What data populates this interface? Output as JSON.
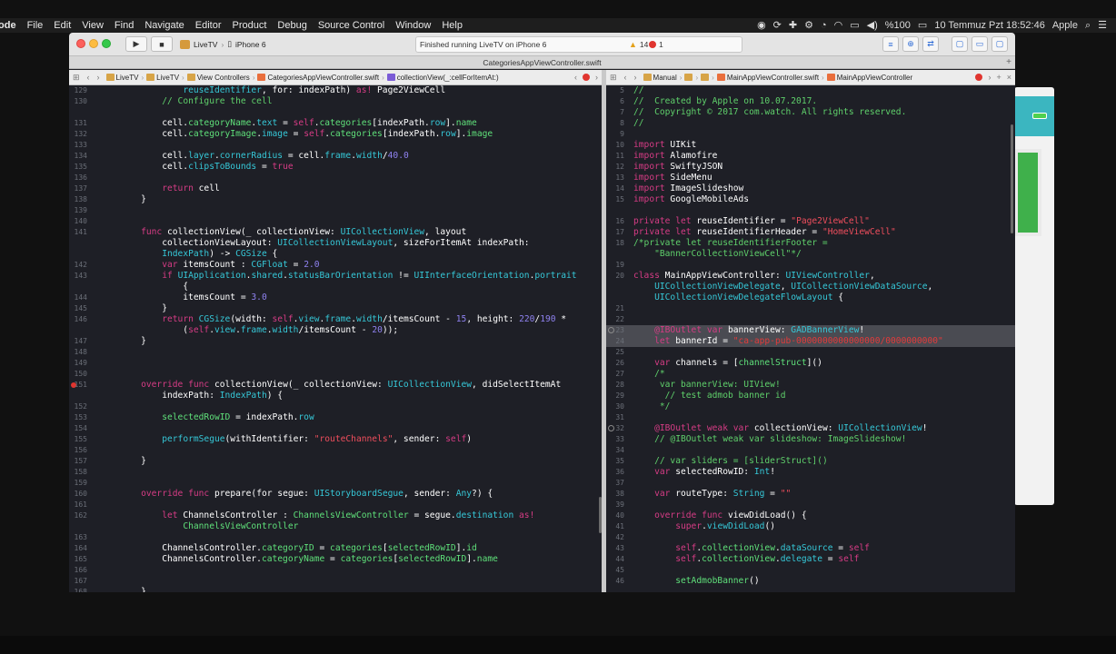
{
  "menubar": {
    "app": "ode",
    "items": [
      "File",
      "Edit",
      "View",
      "Find",
      "Navigate",
      "Editor",
      "Product",
      "Debug",
      "Source Control",
      "Window",
      "Help"
    ],
    "battery": "%100",
    "datetime": "10 Temmuz Pzt  18:52:46",
    "user": "Apple"
  },
  "toolbar": {
    "scheme": "LiveTV",
    "device": "iPhone 6",
    "status": "Finished running LiveTV on iPhone 6",
    "warnings": "14",
    "errors": "1",
    "window_title": "CategoriesAppViewController.swift"
  },
  "left_jump": [
    "LiveTV",
    "LiveTV",
    "View Controllers",
    "CategoriesAppViewController.swift",
    "collectionView(_:cellForItemAt:)"
  ],
  "right_jump": [
    "Manual",
    "MainAppViewController.swift",
    "MainAppViewController"
  ],
  "left_code": [
    {
      "n": "129",
      "h": "            <span class=\"t\">reuseIdentifier</span>, for: indexPath) <span class=\"k\">as!</span> Page2ViewCell"
    },
    {
      "n": "130",
      "h": "        <span class=\"c\">// Configure the cell</span>"
    },
    {
      "n": "",
      "h": ""
    },
    {
      "n": "131",
      "h": "        cell.<span class=\"p\">categoryName</span>.<span class=\"t\">text</span> = <span class=\"k\">self</span>.<span class=\"p\">categories</span>[indexPath.<span class=\"t\">row</span>].<span class=\"p\">name</span>"
    },
    {
      "n": "132",
      "h": "        cell.<span class=\"p\">categoryImage</span>.<span class=\"t\">image</span> = <span class=\"k\">self</span>.<span class=\"p\">categories</span>[indexPath.<span class=\"t\">row</span>].<span class=\"p\">image</span>"
    },
    {
      "n": "133",
      "h": ""
    },
    {
      "n": "134",
      "h": "        cell.<span class=\"t\">layer</span>.<span class=\"t\">cornerRadius</span> = cell.<span class=\"t\">frame</span>.<span class=\"t\">width</span>/<span class=\"n\">40.0</span>"
    },
    {
      "n": "135",
      "h": "        cell.<span class=\"t\">clipsToBounds</span> = <span class=\"k\">true</span>"
    },
    {
      "n": "136",
      "h": ""
    },
    {
      "n": "137",
      "h": "        <span class=\"k\">return</span> cell"
    },
    {
      "n": "138",
      "h": "    }"
    },
    {
      "n": "139",
      "h": ""
    },
    {
      "n": "140",
      "h": ""
    },
    {
      "n": "141",
      "h": "    <span class=\"k\">func</span> collectionView(_ collectionView: <span class=\"t\">UICollectionView</span>, layout"
    },
    {
      "n": "",
      "h": "        collectionViewLayout: <span class=\"t\">UICollectionViewLayout</span>, sizeForItemAt indexPath:"
    },
    {
      "n": "",
      "h": "        <span class=\"t\">IndexPath</span>) -&gt; <span class=\"t\">CGSize</span> {"
    },
    {
      "n": "142",
      "h": "        <span class=\"k\">var</span> itemsCount : <span class=\"t\">CGFloat</span> = <span class=\"n\">2.0</span>"
    },
    {
      "n": "143",
      "h": "        <span class=\"k\">if</span> <span class=\"t\">UIApplication</span>.<span class=\"t\">shared</span>.<span class=\"t\">statusBarOrientation</span> != <span class=\"t\">UIInterfaceOrientation</span>.<span class=\"t\">portrait</span>"
    },
    {
      "n": "",
      "h": "            {"
    },
    {
      "n": "144",
      "h": "            itemsCount = <span class=\"n\">3.0</span>"
    },
    {
      "n": "145",
      "h": "        }"
    },
    {
      "n": "146",
      "h": "        <span class=\"k\">return</span> <span class=\"t\">CGSize</span>(width: <span class=\"k\">self</span>.<span class=\"t\">view</span>.<span class=\"t\">frame</span>.<span class=\"t\">width</span>/itemsCount - <span class=\"n\">15</span>, height: <span class=\"n\">220</span>/<span class=\"n\">190</span> *"
    },
    {
      "n": "",
      "h": "            (<span class=\"k\">self</span>.<span class=\"t\">view</span>.<span class=\"t\">frame</span>.<span class=\"t\">width</span>/itemsCount - <span class=\"n\">20</span>));"
    },
    {
      "n": "147",
      "h": "    }"
    },
    {
      "n": "148",
      "h": ""
    },
    {
      "n": "149",
      "h": ""
    },
    {
      "n": "150",
      "h": ""
    },
    {
      "n": "151",
      "h": "    <span class=\"k\">override</span> <span class=\"k\">func</span> collectionView(_ collectionView: <span class=\"t\">UICollectionView</span>, didSelectItemAt",
      "bp": true
    },
    {
      "n": "",
      "h": "        indexPath: <span class=\"t\">IndexPath</span>) {"
    },
    {
      "n": "152",
      "h": ""
    },
    {
      "n": "153",
      "h": "        <span class=\"p\">selectedRowID</span> = indexPath.<span class=\"t\">row</span>"
    },
    {
      "n": "154",
      "h": ""
    },
    {
      "n": "155",
      "h": "        <span class=\"t\">performSegue</span>(withIdentifier: <span class=\"s\">\"routeChannels\"</span>, sender: <span class=\"k\">self</span>)"
    },
    {
      "n": "156",
      "h": ""
    },
    {
      "n": "157",
      "h": "    }"
    },
    {
      "n": "158",
      "h": ""
    },
    {
      "n": "159",
      "h": ""
    },
    {
      "n": "160",
      "h": "    <span class=\"k\">override</span> <span class=\"k\">func</span> prepare(for segue: <span class=\"t\">UIStoryboardSegue</span>, sender: <span class=\"t\">Any</span>?) {"
    },
    {
      "n": "161",
      "h": ""
    },
    {
      "n": "162",
      "h": "        <span class=\"k\">let</span> ChannelsController : <span class=\"p\">ChannelsViewController</span> = segue.<span class=\"t\">destination</span> <span class=\"k\">as!</span>"
    },
    {
      "n": "",
      "h": "            <span class=\"p\">ChannelsViewController</span>"
    },
    {
      "n": "163",
      "h": ""
    },
    {
      "n": "164",
      "h": "        ChannelsController.<span class=\"p\">categoryID</span> = <span class=\"p\">categories</span>[<span class=\"p\">selectedRowID</span>].<span class=\"p\">id</span>"
    },
    {
      "n": "165",
      "h": "        ChannelsController.<span class=\"p\">categoryName</span> = <span class=\"p\">categories</span>[<span class=\"p\">selectedRowID</span>].<span class=\"p\">name</span>"
    },
    {
      "n": "166",
      "h": ""
    },
    {
      "n": "167",
      "h": ""
    },
    {
      "n": "168",
      "h": "    }"
    }
  ],
  "right_code": [
    {
      "n": "5",
      "h": "<span class=\"c\">//</span>"
    },
    {
      "n": "6",
      "h": "<span class=\"c\">//  Created by Apple on 10.07.2017.</span>"
    },
    {
      "n": "7",
      "h": "<span class=\"c\">//  Copyright © 2017 com.watch. All rights reserved.</span>"
    },
    {
      "n": "8",
      "h": "<span class=\"c\">//</span>"
    },
    {
      "n": "9",
      "h": ""
    },
    {
      "n": "10",
      "h": "<span class=\"k\">import</span> UIKit"
    },
    {
      "n": "11",
      "h": "<span class=\"k\">import</span> Alamofire"
    },
    {
      "n": "12",
      "h": "<span class=\"k\">import</span> SwiftyJSON"
    },
    {
      "n": "13",
      "h": "<span class=\"k\">import</span> SideMenu"
    },
    {
      "n": "14",
      "h": "<span class=\"k\">import</span> ImageSlideshow"
    },
    {
      "n": "15",
      "h": "<span class=\"k\">import</span> GoogleMobileAds"
    },
    {
      "n": "",
      "h": ""
    },
    {
      "n": "16",
      "h": "<span class=\"k\">private</span> <span class=\"k\">let</span> reuseIdentifier = <span class=\"s\">\"Page2ViewCell\"</span>"
    },
    {
      "n": "17",
      "h": "<span class=\"k\">private</span> <span class=\"k\">let</span> reuseIdentifierHeader = <span class=\"s\">\"HomeViewCell\"</span>"
    },
    {
      "n": "18",
      "h": "<span class=\"c\">/*private let reuseIdentifierFooter =</span>"
    },
    {
      "n": "",
      "h": "<span class=\"c\">    \"BannerCollectionViewCell\"*/</span>"
    },
    {
      "n": "19",
      "h": ""
    },
    {
      "n": "20",
      "h": "<span class=\"k\">class</span> MainAppViewController: <span class=\"t\">UIViewController</span>,"
    },
    {
      "n": "",
      "h": "    <span class=\"t\">UICollectionViewDelegate</span>, <span class=\"t\">UICollectionViewDataSource</span>,"
    },
    {
      "n": "",
      "h": "    <span class=\"t\">UICollectionViewDelegateFlowLayout</span> {"
    },
    {
      "n": "21",
      "h": ""
    },
    {
      "n": "22",
      "h": ""
    },
    {
      "n": "23",
      "h": "    <span class=\"k\">@IBOutlet</span> <span class=\"k\">var</span> bannerView: <span class=\"t\">GADBannerView</span>!",
      "hl": true,
      "ob": true
    },
    {
      "n": "24",
      "h": "    <span class=\"k\">let</span> bannerId = <span class=\"red\">\"ca-app-pub-0000000000000000/0000000000\"</span>",
      "hl": true
    },
    {
      "n": "25",
      "h": ""
    },
    {
      "n": "26",
      "h": "    <span class=\"k\">var</span> channels = [<span class=\"p\">channelStruct</span>]()"
    },
    {
      "n": "27",
      "h": "    <span class=\"c\">/*</span>"
    },
    {
      "n": "28",
      "h": "<span class=\"c\">     var bannerView: UIView!</span>"
    },
    {
      "n": "29",
      "h": "<span class=\"c\">      // test admob banner id</span>"
    },
    {
      "n": "30",
      "h": "<span class=\"c\">     */</span>"
    },
    {
      "n": "31",
      "h": ""
    },
    {
      "n": "32",
      "h": "    <span class=\"k\">@IBOutlet</span> <span class=\"k\">weak</span> <span class=\"k\">var</span> collectionView: <span class=\"t\">UICollectionView</span>!",
      "ob": true
    },
    {
      "n": "33",
      "h": "    <span class=\"c\">// @IBOutlet weak var slideshow: ImageSlideshow!</span>"
    },
    {
      "n": "34",
      "h": ""
    },
    {
      "n": "35",
      "h": "    <span class=\"c\">// var sliders = [sliderStruct]()</span>"
    },
    {
      "n": "36",
      "h": "    <span class=\"k\">var</span> selectedRowID: <span class=\"t\">Int</span>!"
    },
    {
      "n": "37",
      "h": ""
    },
    {
      "n": "38",
      "h": "    <span class=\"k\">var</span> routeType: <span class=\"t\">String</span> = <span class=\"s\">\"\"</span>"
    },
    {
      "n": "39",
      "h": ""
    },
    {
      "n": "40",
      "h": "    <span class=\"k\">override</span> <span class=\"k\">func</span> viewDidLoad() {"
    },
    {
      "n": "41",
      "h": "        <span class=\"k\">super</span>.<span class=\"t\">viewDidLoad</span>()"
    },
    {
      "n": "42",
      "h": ""
    },
    {
      "n": "43",
      "h": "        <span class=\"k\">self</span>.<span class=\"p\">collectionView</span>.<span class=\"t\">dataSource</span> = <span class=\"k\">self</span>"
    },
    {
      "n": "44",
      "h": "        <span class=\"k\">self</span>.<span class=\"p\">collectionView</span>.<span class=\"t\">delegate</span> = <span class=\"k\">self</span>"
    },
    {
      "n": "45",
      "h": ""
    },
    {
      "n": "46",
      "h": "        <span class=\"p\">setAdmobBanner</span>()"
    }
  ]
}
